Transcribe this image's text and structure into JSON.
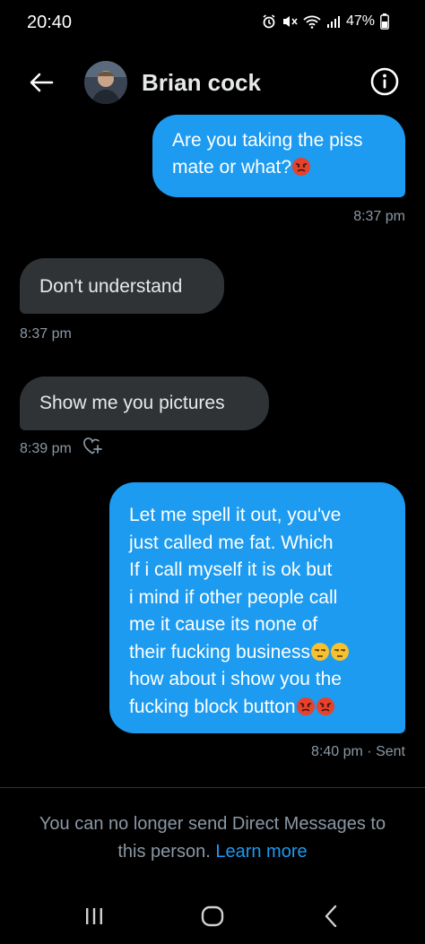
{
  "status_bar": {
    "time": "20:40",
    "battery": "47%",
    "icons": [
      "alarm-icon",
      "mute-icon",
      "wifi-icon",
      "signal-icon",
      "battery-icon"
    ]
  },
  "header": {
    "contact_name": "Brian cock",
    "back_icon": "back-arrow-icon",
    "info_icon": "info-icon"
  },
  "messages": [
    {
      "direction": "sent",
      "lines": [
        "Are you taking the piss",
        "mate or what?"
      ],
      "trailing_emoji": [
        "angry-face"
      ],
      "time": "8:37 pm"
    },
    {
      "direction": "received",
      "lines": [
        "Don't understand"
      ],
      "time": "8:37 pm"
    },
    {
      "direction": "received",
      "lines": [
        "Show me you pictures"
      ],
      "time": "8:39 pm",
      "reaction_icon": "add-reaction-heart-icon"
    },
    {
      "direction": "sent",
      "lines": [
        "Let me spell it out, you've",
        "just called me fat. Which",
        "If i call myself it is ok but",
        "i mind if other people call",
        "me it  cause its none of",
        "their fucking business",
        "how about i show you the",
        "fucking block button"
      ],
      "time": "8:40 pm · Sent"
    }
  ],
  "notice": {
    "line1": "You can no longer send Direct Messages to",
    "line2_prefix": "this person. ",
    "link": "Learn more"
  },
  "navbar": {
    "icons": [
      "recent-apps-icon",
      "home-icon",
      "back-icon"
    ]
  },
  "colors": {
    "background": "#000000",
    "sent_bubble": "#1d9bf0",
    "received_bubble": "#2f3336",
    "meta_text": "#8b98a5",
    "link": "#1d9bf0"
  }
}
